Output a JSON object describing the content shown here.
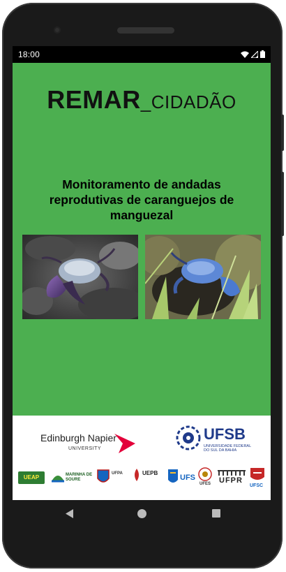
{
  "status_bar": {
    "time": "18:00",
    "icons": [
      "wifi-icon",
      "signal-icon",
      "battery-icon"
    ]
  },
  "app": {
    "title_bold": "REMAR",
    "title_light": "_CIDADÃO",
    "subtitle": "Monitoramento de andadas reprodutivas de caranguejos de manguezal",
    "background_color": "#4caf50"
  },
  "photos": [
    {
      "name": "crab-photo-purple-claw"
    },
    {
      "name": "crab-photo-blue"
    }
  ],
  "logos": {
    "edinburgh_napier": {
      "name": "Edinburgh Napier",
      "sub": "UNIVERSITY"
    },
    "ufsb": {
      "name": "UFSB",
      "sub": "UNIVERSIDADE FEDERAL DO SUL DA BAHIA"
    },
    "partners": [
      {
        "label": "UEAP"
      },
      {
        "label": "MARINHA DE SOURE"
      },
      {
        "label": "UFPA"
      },
      {
        "label": "UEPB"
      },
      {
        "label": "UFS"
      },
      {
        "label": "UFES"
      },
      {
        "label": "UFPR"
      },
      {
        "label": "UFSC"
      }
    ]
  },
  "nav_bar": {
    "back": "back-icon",
    "home": "home-icon",
    "recent": "recent-apps-icon"
  }
}
